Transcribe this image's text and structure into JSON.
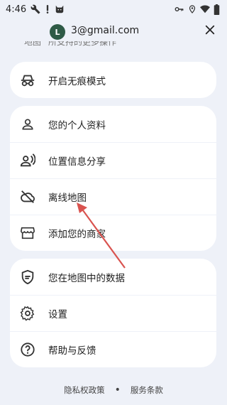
{
  "status_bar": {
    "time": "4:46",
    "left_icons": [
      "wrench-icon",
      "exclamation-icon",
      "cat-icon"
    ],
    "right_icons": [
      "key-icon",
      "location-icon",
      "wifi-icon",
      "battery-icon"
    ]
  },
  "account": {
    "avatar_letter": "L",
    "email": "3@gmail.com",
    "close_icon": "close-icon"
  },
  "scrolled_text": "地图 “所支持的更多操作",
  "menu_groups": [
    [
      {
        "label": "开启无痕模式",
        "icon": "incognito-icon"
      }
    ],
    [
      {
        "label": "您的个人资料",
        "icon": "person-icon"
      },
      {
        "label": "位置信息分享",
        "icon": "location-sharing-icon"
      },
      {
        "label": "离线地图",
        "icon": "cloud-off-icon"
      },
      {
        "label": "添加您的商家",
        "icon": "storefront-icon"
      }
    ],
    [
      {
        "label": "您在地图中的数据",
        "icon": "data-shield-icon"
      },
      {
        "label": "设置",
        "icon": "gear-icon"
      },
      {
        "label": "帮助与反馈",
        "icon": "help-icon"
      }
    ]
  ],
  "footer": {
    "privacy": "隐私权政策",
    "separator": "•",
    "terms": "服务条款"
  },
  "colors": {
    "background": "#eef1f8",
    "card": "#ffffff",
    "avatar": "#2e5a46",
    "annotation_arrow": "#d9534f"
  }
}
